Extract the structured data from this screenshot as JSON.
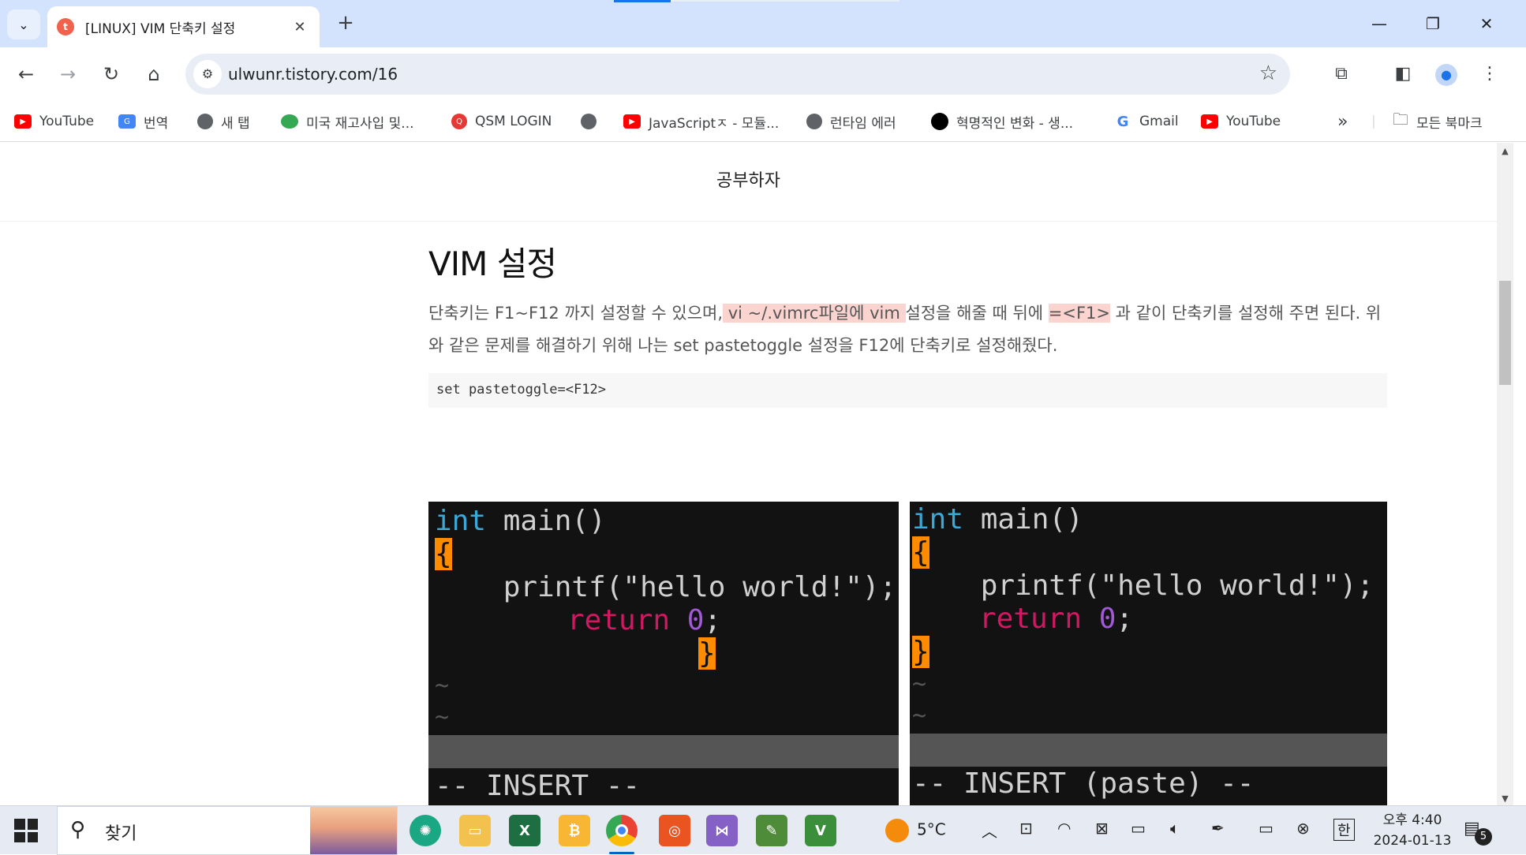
{
  "browser": {
    "tab_title": "[LINUX] VIM 단축키 설정",
    "tab_close": "✕",
    "new_tab": "+",
    "url": "ulwunr.tistory.com/16",
    "window_controls": {
      "minimize": "—",
      "restore": "❐",
      "close": "✕"
    }
  },
  "bookmarks": [
    {
      "label": "YouTube",
      "icon": "youtube-icon"
    },
    {
      "label": "번역",
      "icon": "translate-icon"
    },
    {
      "label": "새 탭",
      "icon": "globe-icon"
    },
    {
      "label": "미국 재고사입 및...",
      "icon": "cup-icon"
    },
    {
      "label": "QSM LOGIN",
      "icon": "qsm-icon"
    },
    {
      "label": "",
      "icon": "globe-icon"
    },
    {
      "label": "JavaScriptㅈ - 모듈...",
      "icon": "youtube-icon"
    },
    {
      "label": "런타임 에러",
      "icon": "globe-icon"
    },
    {
      "label": "혁명적인 변화 - 생...",
      "icon": "circle-icon"
    },
    {
      "label": "Gmail",
      "icon": "google-icon"
    },
    {
      "label": "YouTube",
      "icon": "youtube-icon"
    }
  ],
  "bookmarks_more": "»",
  "all_bookmarks": "모든 북마크",
  "blog": {
    "name": "공부하자",
    "post_title": "VIM 설정",
    "para_part1": "단축키는 F1~F12 까지 설정할 수 있으며,",
    "para_hl1": " vi ~/.vimrc파일에 vim ",
    "para_part2": "설정을 해줄 때 뒤에 ",
    "para_hl2": "=<F1>",
    "para_part3": " 과 같이 단축키를 설정해 주면 된다. 위와 같은 문제를 해결하기 위해 나는 set pastetoggle 설정을 F12에 단축키로 설정해줬다.",
    "code": "set pastetoggle=<F12>"
  },
  "terminal_left": {
    "int": "int",
    "main": " main()",
    "open_brace": "{",
    "printf": "    printf(\"hello world!\");",
    "return": "return",
    "zero": "0",
    "semi": ";",
    "close_brace": "}",
    "tilde": "~",
    "mode": "-- INSERT --"
  },
  "terminal_right": {
    "int": "int",
    "main": " main()",
    "open_brace": "{",
    "printf": "    printf(\"hello world!\");",
    "return": "return",
    "zero": "0",
    "semi": ";",
    "close_brace": "}",
    "tilde": "~",
    "mode": "-- INSERT (paste) --"
  },
  "taskbar": {
    "search_placeholder": "찾기",
    "weather": "5°C",
    "ime": "한",
    "time": "오후 4:40",
    "date": "2024-01-13",
    "notifications": "5"
  }
}
